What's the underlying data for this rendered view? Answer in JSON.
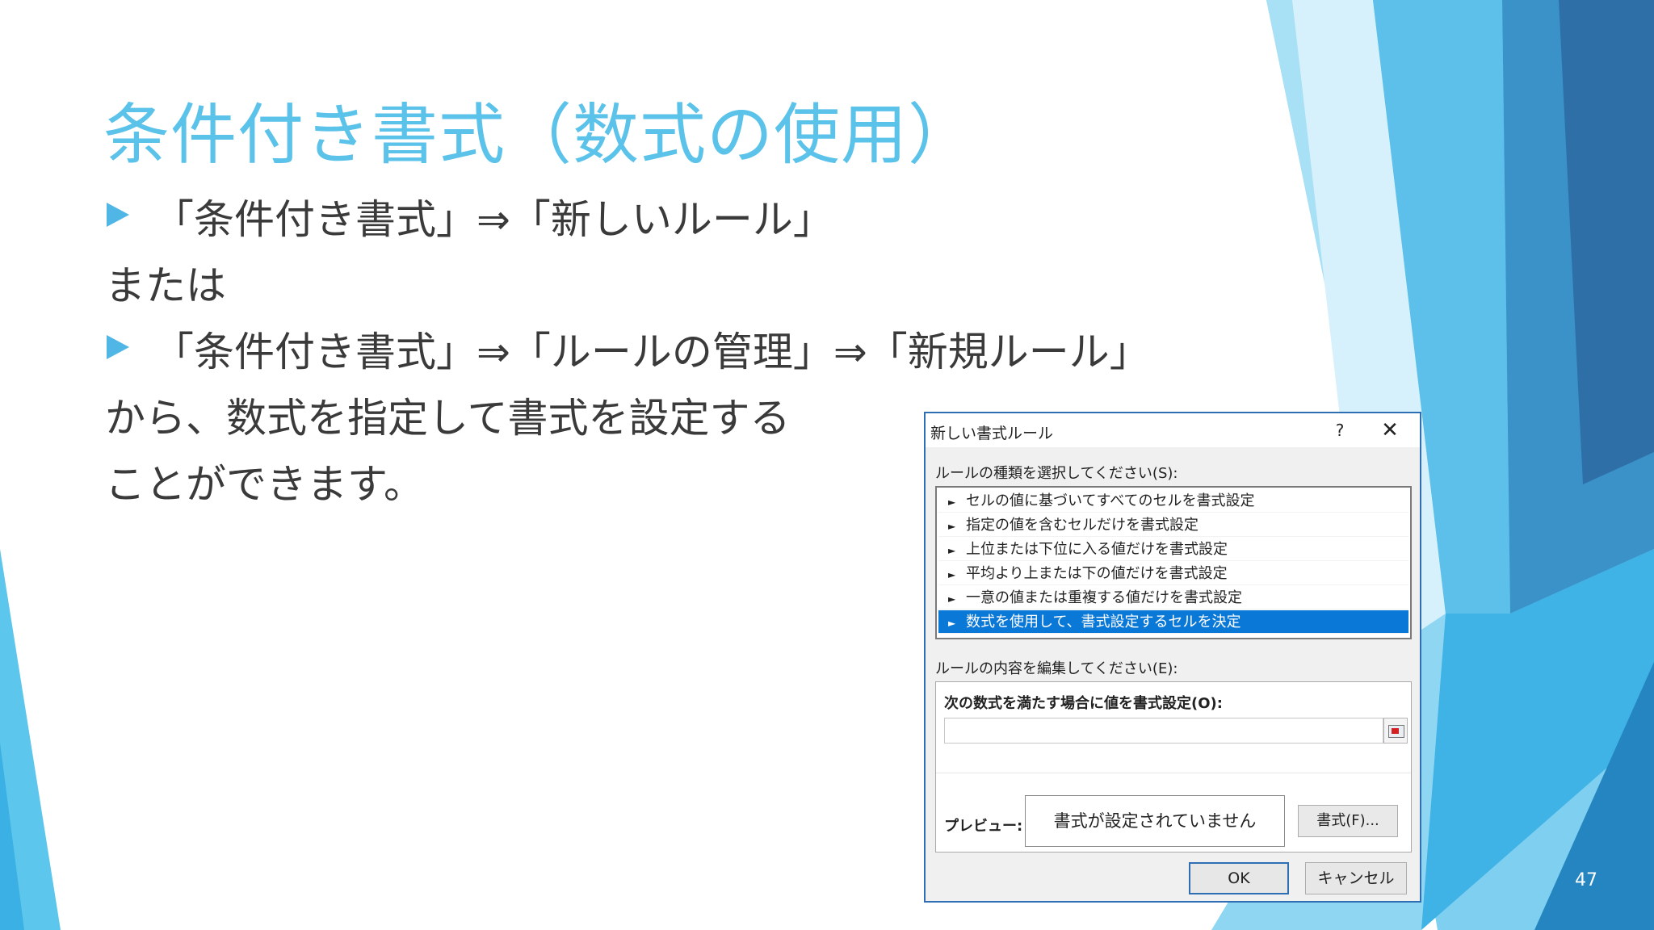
{
  "slide": {
    "title": "条件付き書式（数式の使用）",
    "line1": "「条件付き書式」⇒「新しいルール」",
    "line2": "または",
    "line3": "「条件付き書式」⇒「ルールの管理」⇒「新規ルール」",
    "line4": "から、数式を指定して書式を設定する",
    "line5": "ことができます。",
    "page_number": "47"
  },
  "dialog": {
    "title": "新しい書式ルール",
    "help_label": "?",
    "close_label": "✕",
    "rule_type_label": "ルールの種類を選択してください(S):",
    "rule_types": [
      "セルの値に基づいてすべてのセルを書式設定",
      "指定の値を含むセルだけを書式設定",
      "上位または下位に入る値だけを書式設定",
      "平均より上または下の値だけを書式設定",
      "一意の値または重複する値だけを書式設定",
      "数式を使用して、書式設定するセルを決定"
    ],
    "selected_rule_index": 5,
    "edit_label": "ルールの内容を編集してください(E):",
    "formula_label": "次の数式を満たす場合に値を書式設定(O):",
    "formula_value": "",
    "preview_label": "プレビュー:",
    "preview_text": "書式が設定されていません",
    "format_button": "書式(F)...",
    "ok_button": "OK",
    "cancel_button": "キャンセル"
  },
  "colors": {
    "accent": "#5bc2ea",
    "selection": "#0a78d7",
    "dialog_border": "#2e6fb3"
  }
}
